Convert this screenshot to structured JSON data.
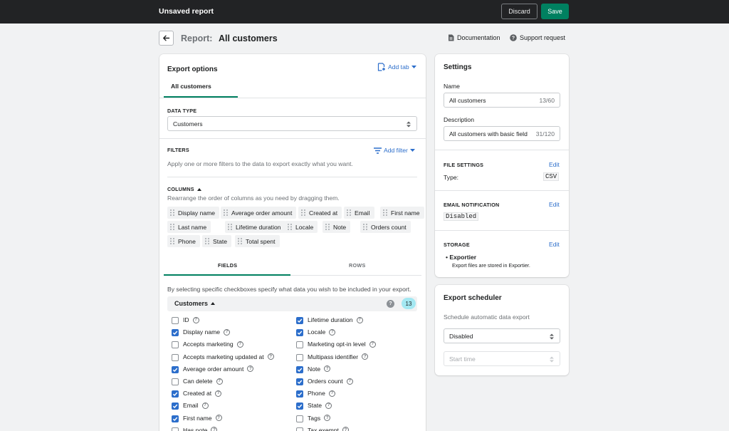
{
  "topbar": {
    "title": "Unsaved report",
    "discard": "Discard",
    "save": "Save"
  },
  "header": {
    "prefix": "Report:",
    "title": "All customers",
    "documentation": "Documentation",
    "support": "Support request"
  },
  "export": {
    "title": "Export options",
    "add_tab": "Add tab",
    "active_tab": "All customers",
    "data_type_label": "DATA TYPE",
    "data_type_value": "Customers",
    "filters_label": "FILTERS",
    "add_filter": "Add filter",
    "filters_help": "Apply one or more filters to the data to export exactly what you want.",
    "columns_label": "COLUMNS",
    "columns_help": "Rearrange the order of columns as you need by dragging them.",
    "columns": [
      "Display name",
      "Average order amount",
      "Created at",
      "Email",
      "First name",
      "Last name",
      "Lifetime duration",
      "Locale",
      "Note",
      "Orders count",
      "Phone",
      "State",
      "Total spent"
    ],
    "tabs": [
      "FIELDS",
      "ROWS"
    ],
    "fields_help": "By selecting specific checkboxes specify what data you wish to be included in your export.",
    "group_name": "Customers",
    "group_count": "13",
    "help_mark": "?",
    "fields_left": [
      {
        "label": "ID",
        "checked": false
      },
      {
        "label": "Display name",
        "checked": true
      },
      {
        "label": "Accepts marketing",
        "checked": false
      },
      {
        "label": "Accepts marketing updated at",
        "checked": false
      },
      {
        "label": "Average order amount",
        "checked": true
      },
      {
        "label": "Can delete",
        "checked": false
      },
      {
        "label": "Created at",
        "checked": true
      },
      {
        "label": "Email",
        "checked": true
      },
      {
        "label": "First name",
        "checked": true
      },
      {
        "label": "Has note",
        "checked": false
      }
    ],
    "fields_right": [
      {
        "label": "Lifetime duration",
        "checked": true
      },
      {
        "label": "Locale",
        "checked": true
      },
      {
        "label": "Marketing opt-in level",
        "checked": false
      },
      {
        "label": "Multipass identifier",
        "checked": false
      },
      {
        "label": "Note",
        "checked": true
      },
      {
        "label": "Orders count",
        "checked": true
      },
      {
        "label": "Phone",
        "checked": true
      },
      {
        "label": "State",
        "checked": true
      },
      {
        "label": "Tags",
        "checked": false
      },
      {
        "label": "Tax exempt",
        "checked": false
      }
    ]
  },
  "settings": {
    "title": "Settings",
    "name_label": "Name",
    "name_value": "All customers",
    "name_count": "13/60",
    "desc_label": "Description",
    "desc_value": "All customers with basic field",
    "desc_count": "31/120",
    "file_label": "FILE SETTINGS",
    "file_type_label": "Type:",
    "file_type_value": "CSV",
    "email_label": "EMAIL NOTIFICATION",
    "email_value": "Disabled",
    "storage_label": "STORAGE",
    "storage_item": "Exportier",
    "storage_desc": "Export files are stored in Exportier.",
    "edit": "Edit"
  },
  "scheduler": {
    "title": "Export scheduler",
    "subtitle": "Schedule automatic data export",
    "select_value": "Disabled",
    "start_placeholder": "Start time"
  },
  "colors": {
    "accent": "#008060",
    "link": "#2c6ecb",
    "badge": "#a4e8f2"
  }
}
